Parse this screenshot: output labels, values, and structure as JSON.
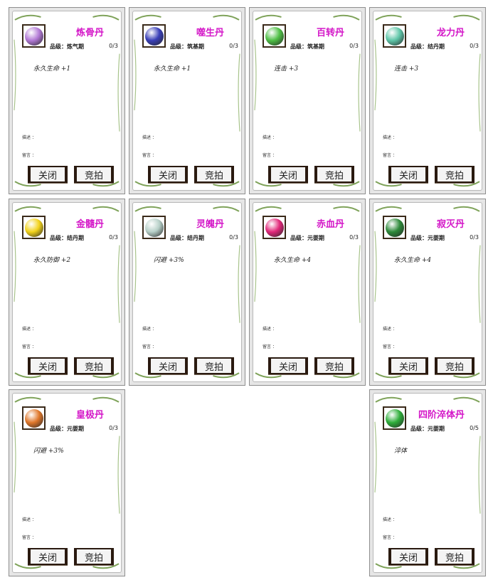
{
  "labels": {
    "grade": "品级：",
    "desc": "描述 ：",
    "msg": "留言 ：",
    "close": "关闭",
    "bid": "竞拍"
  },
  "cards": [
    {
      "name": "炼骨丹",
      "grade": "炼气期",
      "count": "0/3",
      "effect": "永久生命 +1",
      "icon": "purple-pill-icon",
      "color": "#b37ad6"
    },
    {
      "name": "噬生丹",
      "grade": "筑基期",
      "count": "0/3",
      "effect": "永久生命 +1",
      "icon": "dark-orb-icon",
      "color": "#3a3fb8"
    },
    {
      "name": "百转丹",
      "grade": "筑基期",
      "count": "0/3",
      "effect": "连击 +3",
      "icon": "green-cube-icon",
      "color": "#4fbf45"
    },
    {
      "name": "龙力丹",
      "grade": "结丹期",
      "count": "0/3",
      "effect": "连击 +3",
      "icon": "teal-orb-icon",
      "color": "#5fc6a8"
    },
    {
      "name": "金髓丹",
      "grade": "结丹期",
      "count": "0/3",
      "effect": "永久防御 +2",
      "icon": "gold-orb-icon",
      "color": "#f2d21a"
    },
    {
      "name": "灵魄丹",
      "grade": "结丹期",
      "count": "0/3",
      "effect": "闪避 +3%",
      "icon": "pearl-orb-icon",
      "color": "#b7d0c8"
    },
    {
      "name": "赤血丹",
      "grade": "元婴期",
      "count": "0/3",
      "effect": "永久生命 +4",
      "icon": "pink-orb-icon",
      "color": "#e2287a"
    },
    {
      "name": "寂灭丹",
      "grade": "元婴期",
      "count": "0/3",
      "effect": "永久生命 +4",
      "icon": "green-swirl-icon",
      "color": "#2e8a3a"
    },
    {
      "name": "皇极丹",
      "grade": "元婴期",
      "count": "0/3",
      "effect": "闪避 +3%",
      "icon": "orange-chest-icon",
      "color": "#e0772a"
    },
    {
      "name": "四阶淬体丹",
      "grade": "元婴期",
      "count": "0/5",
      "effect": "淬体",
      "icon": "green-bowl-icon",
      "color": "#2fae3a"
    }
  ]
}
